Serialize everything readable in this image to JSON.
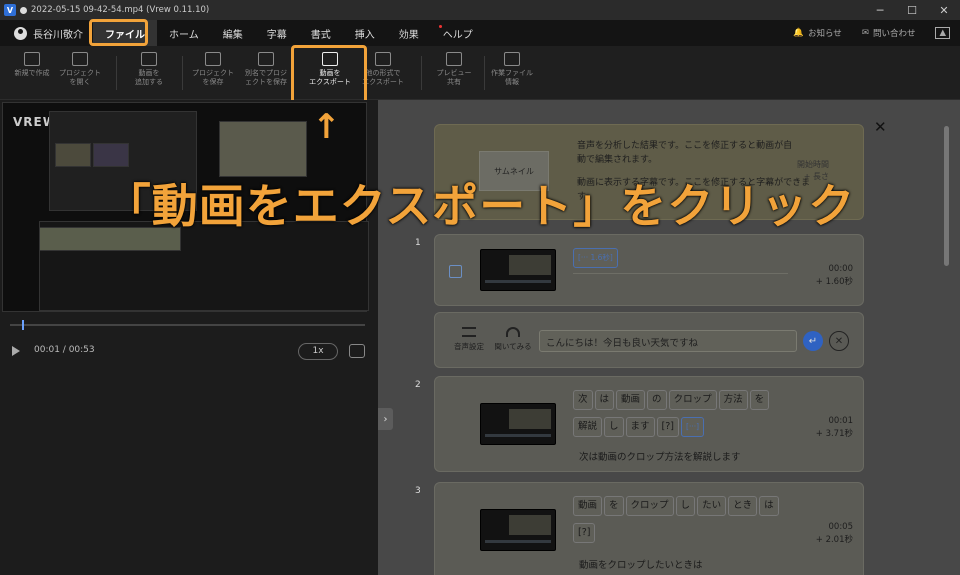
{
  "window": {
    "title": "2022-05-15 09-42-54.mp4 (Vrew 0.11.10)",
    "app_icon_letter": "V"
  },
  "menubar": {
    "user_name": "長谷川敬介",
    "items": [
      "ファイル",
      "ホーム",
      "編集",
      "字幕",
      "書式",
      "挿入",
      "効果",
      "ヘルプ"
    ],
    "active": "ファイル",
    "notifications": "お知らせ",
    "contact": "問い合わせ"
  },
  "toolbar": {
    "tools": [
      {
        "label": "新規で作成"
      },
      {
        "label": "プロジェクト\nを開く"
      },
      {
        "label": "動画を\n追加する"
      },
      {
        "label": "プロジェクト\nを保存"
      },
      {
        "label": "別名でプロジ\nェクトを保存"
      },
      {
        "label": "動画を\nエクスポート"
      },
      {
        "label": "他の形式で\nエクスポート"
      },
      {
        "label": "プレビュー\n共有"
      },
      {
        "label": "作業ファイル\n情報"
      }
    ]
  },
  "player": {
    "logo": "VREW",
    "time": "00:01 / 00:53",
    "speed": "1x"
  },
  "info_card": {
    "thumbnail_label": "サムネイル",
    "text1": "音声を分析した結果です。ここを修正すると動画が自動で編集されます。",
    "text2": "動画に表示する字幕です。ここを修正すると字幕ができます。",
    "start_label": "開始時間",
    "length_label": "+ 長さ"
  },
  "scenes": [
    {
      "number": "1",
      "chips": [
        "[··· 1.6秒]"
      ],
      "time": "00:00",
      "duration": "+ 1.60秒",
      "subtitle": ""
    },
    {
      "number": "2",
      "chips": [
        "次",
        "は",
        "動画",
        "の",
        "クロップ",
        "方法",
        "を",
        "解説",
        "し",
        "ます",
        "[?]",
        "[···]"
      ],
      "time": "00:01",
      "duration": "+ 3.71秒",
      "subtitle": "次は動画のクロップ方法を解説します"
    },
    {
      "number": "3",
      "chips": [
        "動画",
        "を",
        "クロップ",
        "し",
        "たい",
        "とき",
        "は",
        "[?]"
      ],
      "time": "00:05",
      "duration": "+ 2.01秒",
      "subtitle": "動画をクロップしたいときは"
    }
  ],
  "edit_row": {
    "voice_settings": "音声設定",
    "listen": "聞いてみる",
    "input_value": "こんにちは！今日も良い天気ですね"
  },
  "overlay": {
    "arrow": "↑",
    "caption": "「動画をエクスポート」をクリック"
  },
  "colors": {
    "highlight": "#f2a33a",
    "accent_blue": "#2f62c2"
  }
}
